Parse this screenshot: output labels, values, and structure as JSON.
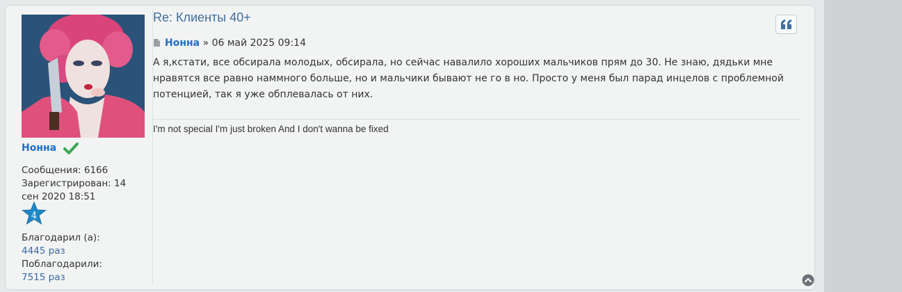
{
  "post": {
    "title": "Re: Клиенты 40+",
    "author": "Нонна",
    "meta_separator": " » ",
    "date": "06 май 2025 09:14",
    "body_lines": [
      "А я,кстати, все обсирала молодых, обсирала, но сейчас навалило хороших мальчиков прям до 30. Не знаю, дядьки мне",
      "нравятся все равно наммного больше, но и мальчики бывают не го в но. Просто у меня был парад инцелов с проблемной",
      "потенцией, так я уже обплевалась от них."
    ],
    "signature": "I'm not special I'm just broken And I don't wanna be fixed"
  },
  "profile": {
    "name": "Нонна",
    "messages": "Сообщения: 6166",
    "registered_line1": "Зарегистрирован: 14",
    "registered_line2": "сен 2020 18:51",
    "rank_number": "4",
    "thanked_label": "Благодарил (а):",
    "thanked_value": "4445 раз",
    "thanked_by_label": "Поблагодарили:",
    "thanked_by_value": "7515 раз"
  },
  "icons": {
    "quote": "quote-icon",
    "top": "chevron-up-circle-icon",
    "verified": "check-icon",
    "post": "document-icon",
    "rank": "star-icon"
  },
  "colors": {
    "link": "#1f6fc4",
    "title": "#3f6f9e",
    "star": "#1e88c7",
    "check": "#3aa655"
  }
}
